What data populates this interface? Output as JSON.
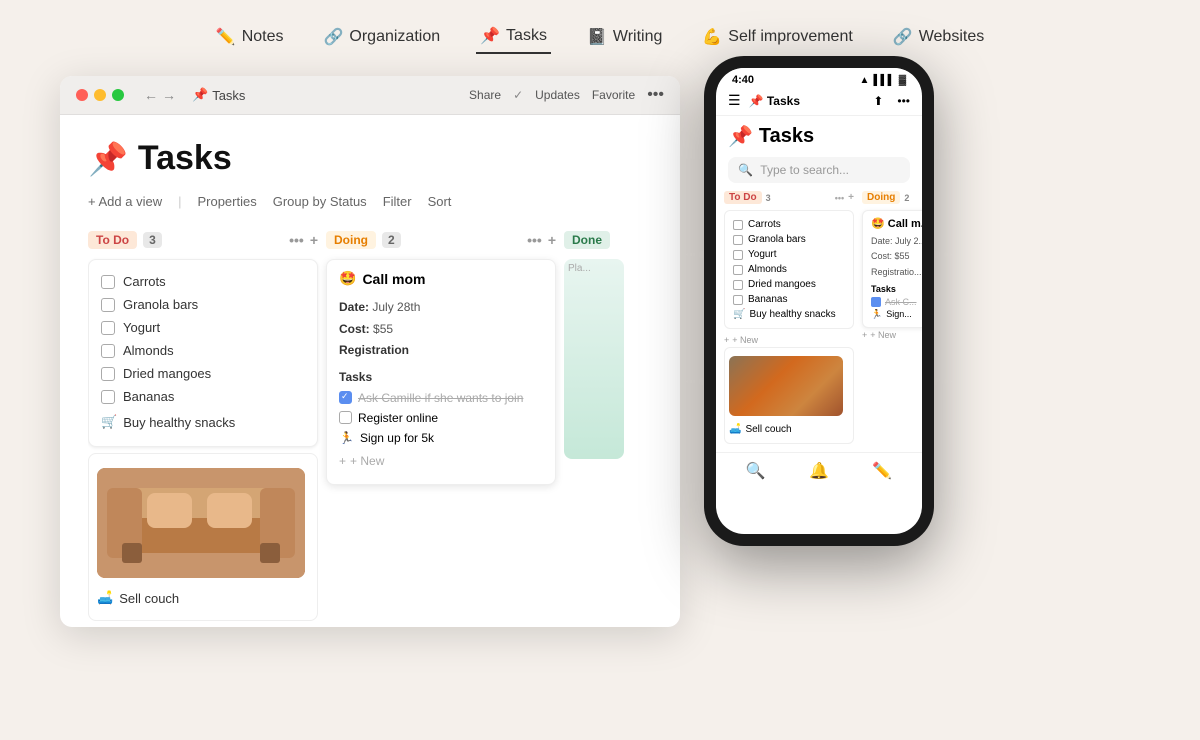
{
  "page": {
    "bg": "#f5f0eb"
  },
  "nav": {
    "items": [
      {
        "id": "notes",
        "emoji": "✏️",
        "label": "Notes",
        "active": false
      },
      {
        "id": "organization",
        "emoji": "🔗",
        "label": "Organization",
        "active": false
      },
      {
        "id": "tasks",
        "emoji": "📌",
        "label": "Tasks",
        "active": true
      },
      {
        "id": "writing",
        "emoji": "📓",
        "label": "Writing",
        "active": false
      },
      {
        "id": "self-improvement",
        "emoji": "💪",
        "label": "Self improvement",
        "active": false
      },
      {
        "id": "websites",
        "emoji": "🔗",
        "label": "Websites",
        "active": false
      }
    ]
  },
  "window": {
    "title": "Tasks",
    "emoji": "📌",
    "actions": {
      "share": "Share",
      "updates": "Updates",
      "favorite": "Favorite"
    }
  },
  "page_title": "Tasks",
  "toolbar": {
    "add_view": "+ Add a view",
    "properties": "Properties",
    "group_by": "Group by",
    "group_by_value": "Status",
    "filter": "Filter",
    "sort": "Sort"
  },
  "kanban": {
    "columns": [
      {
        "id": "todo",
        "label": "To Do",
        "count": 3,
        "tag_class": "tag-todo",
        "items": [
          {
            "type": "checkbox",
            "text": "Carrots"
          },
          {
            "type": "checkbox",
            "text": "Granola bars"
          },
          {
            "type": "checkbox",
            "text": "Yogurt"
          },
          {
            "type": "checkbox",
            "text": "Almonds"
          },
          {
            "type": "checkbox",
            "text": "Dried mangoes"
          },
          {
            "type": "checkbox",
            "text": "Bananas"
          },
          {
            "type": "special",
            "emoji": "🛒",
            "text": "Buy healthy snacks"
          }
        ],
        "sofa_item": {
          "emoji": "🛋️",
          "text": "Sell couch"
        }
      },
      {
        "id": "doing",
        "label": "Doing",
        "count": 2,
        "tag_class": "tag-doing",
        "card": {
          "title": "Call mom",
          "emoji": "🤩",
          "details": {
            "date_label": "Date:",
            "date_value": "July 28th",
            "cost_label": "Cost:",
            "cost_value": "$55",
            "registration_label": "Registration"
          },
          "tasks_label": "Tasks",
          "tasks": [
            {
              "checked": true,
              "text": "Ask Camille if she wants to join",
              "strikethrough": true
            },
            {
              "checked": false,
              "text": "Register online"
            }
          ],
          "special_task": {
            "emoji": "🏃",
            "text": "Sign up for 5k"
          },
          "new_btn": "+ New"
        }
      },
      {
        "id": "done",
        "label": "Done",
        "tag_class": "tag-done"
      }
    ]
  },
  "mobile": {
    "time": "4:40",
    "app_title": "Tasks",
    "emoji": "📌",
    "search_placeholder": "Type to search...",
    "todo_col": {
      "label": "To Do",
      "count": 3,
      "items": [
        "Carrots",
        "Granola bars",
        "Yogurt",
        "Almonds",
        "Dried mangoes",
        "Bananas"
      ],
      "special": "Buy healthy snacks",
      "special_emoji": "🛒",
      "sell_text": "Sell couch",
      "sell_emoji": "🛋️"
    },
    "doing_col": {
      "label": "Doing",
      "card_title": "Call m...",
      "card_emoji": "🤩",
      "detail_date": "Date: July 2...",
      "detail_cost": "Cost: $55",
      "reg_label": "Registratio...",
      "tasks_label": "Tasks",
      "task1": "Ask C...",
      "sign_up": "Sign..."
    },
    "new_btn": "+ New",
    "bottom_search": "🔍",
    "bottom_bell": "🔔",
    "bottom_edit": "✏️"
  }
}
